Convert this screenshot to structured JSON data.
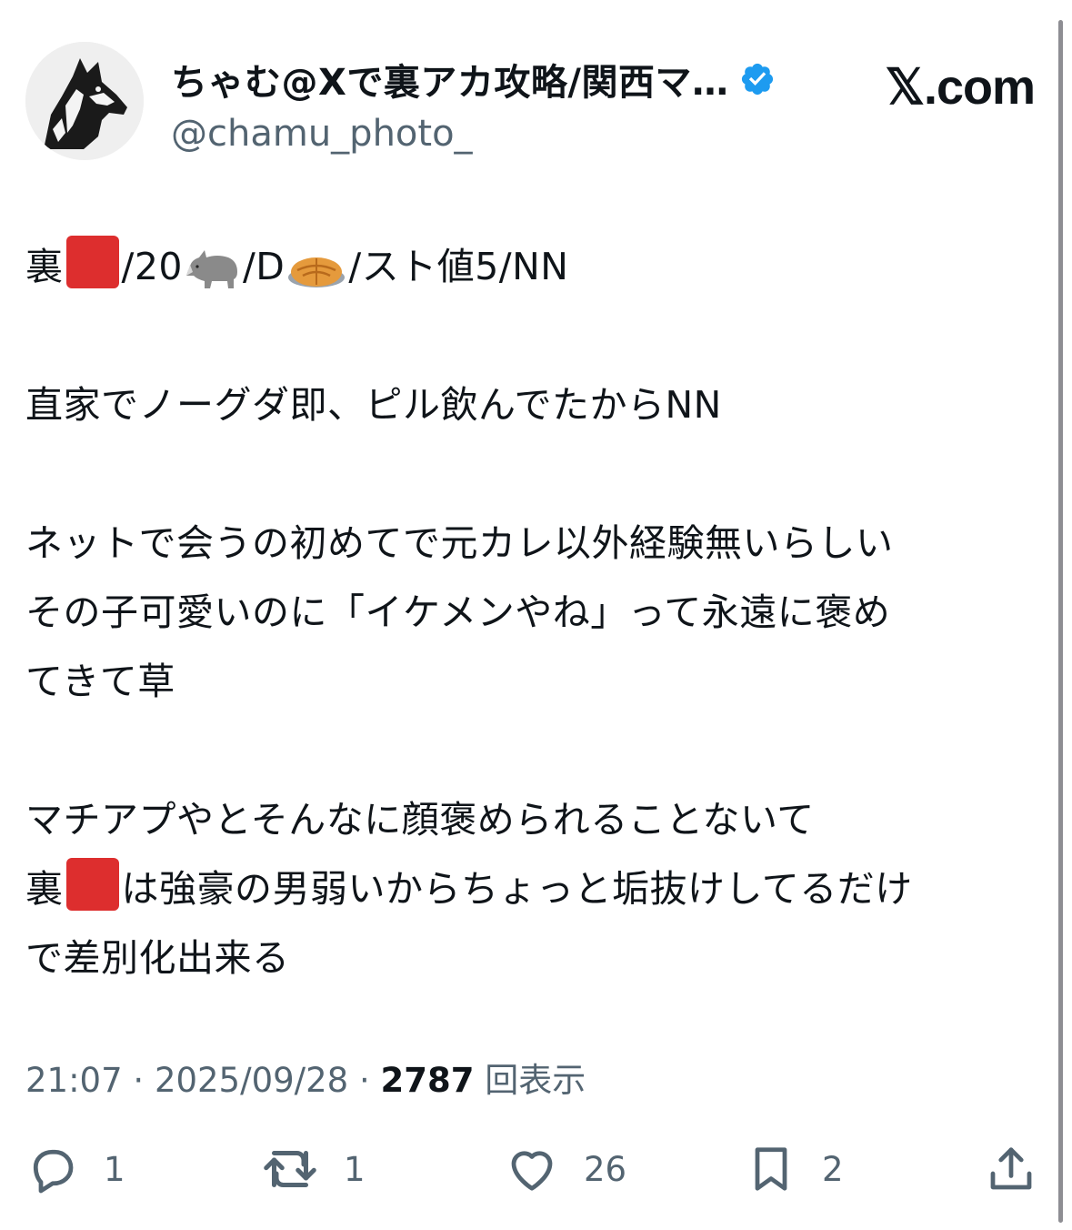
{
  "header": {
    "display_name": "ちゃむ@Xで裏アカ攻略/関西マ…",
    "handle": "@chamu_photo_",
    "brand": "𝕏.com",
    "avatar_icon": "wolf-avatar-icon",
    "verified_icon": "verified-badge-icon",
    "verified_color": "#1d9bf0"
  },
  "post": {
    "line1": {
      "t1": "裏",
      "t2": "/20",
      "t3": "/D",
      "t4": "/スト値5/NN"
    },
    "line2": "直家でノーグダ即、ピル飲んでたからNN",
    "line3": "ネットで会うの初めてで元カレ以外経験無いらしい",
    "line4": "その子可愛いのに「イケメンやね」って永遠に褒め",
    "line5": "てきて草",
    "line6": "マチアプやとそんなに顔褒められることないて",
    "line7": {
      "t1": "裏",
      "t2": "は強豪の男弱いからちょっと垢抜けしてるだけ"
    },
    "line8": "で差別化出来る"
  },
  "meta": {
    "time": "21:07",
    "sep1": " · ",
    "date": "2025/09/28",
    "sep2": " · ",
    "views": "2787",
    "views_label": " 回表示"
  },
  "actions": {
    "reply_count": "1",
    "repost_count": "1",
    "like_count": "26",
    "bookmark_count": "2"
  }
}
